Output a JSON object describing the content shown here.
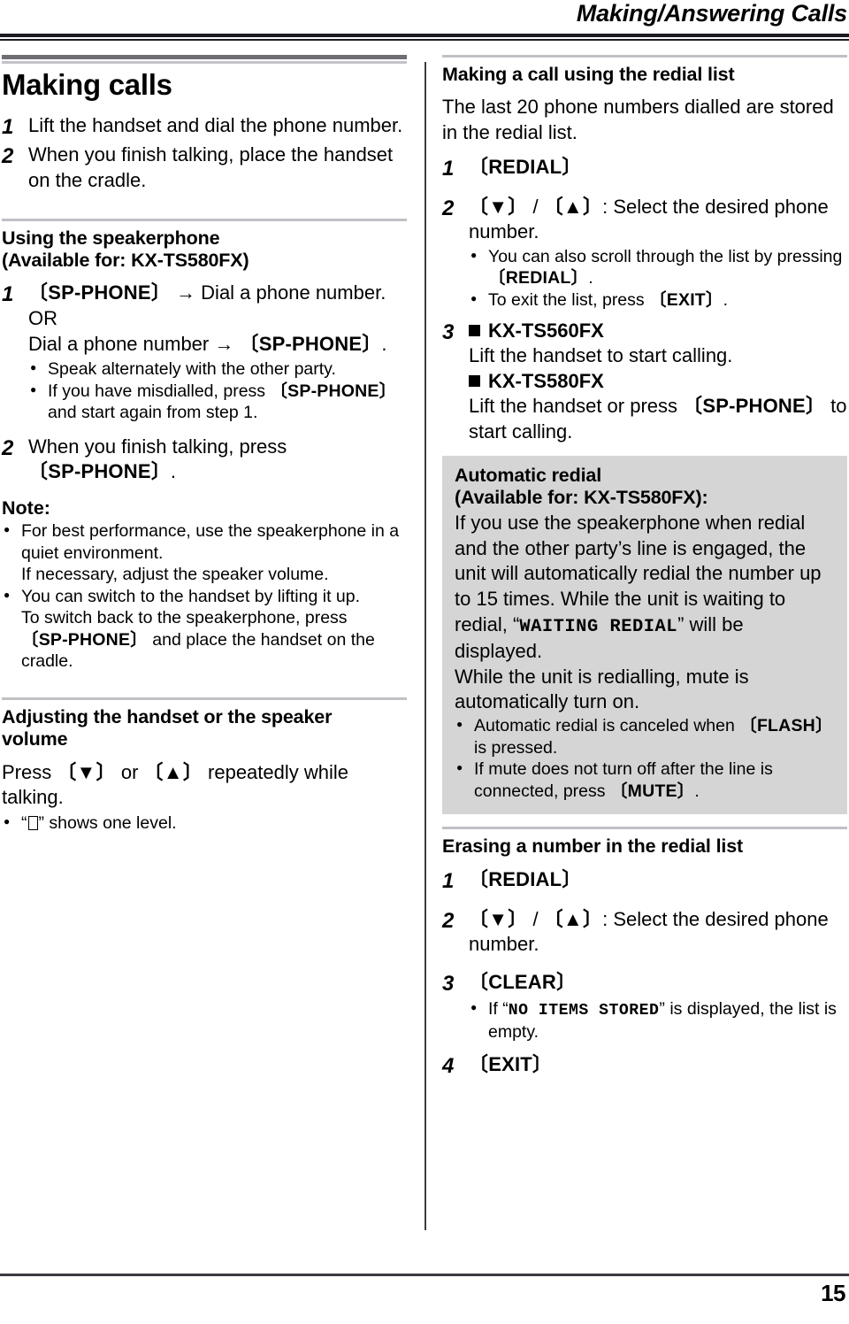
{
  "header": {
    "title": "Making/Answering Calls"
  },
  "footer": {
    "page_number": "15"
  },
  "left_column": {
    "main_title": "Making calls",
    "steps_basic": [
      {
        "num": "1",
        "text": "Lift the handset and dial the phone number."
      },
      {
        "num": "2",
        "text": "When you finish talking, place the handset on the cradle."
      }
    ],
    "speakerphone": {
      "heading_line1": "Using the speakerphone",
      "heading_line2": "(Available for: KX-TS580FX)",
      "step1_num": "1",
      "step1_key": "〔SP-PHONE〕",
      "step1_arrow": "→",
      "step1_rest": "Dial a phone number.",
      "step1_or": "OR",
      "step1_alt_pre": "Dial a phone number",
      "step1_alt_arrow": "→",
      "step1_alt_key": "〔SP-PHONE〕",
      "step1_alt_post": ".",
      "bullets": [
        {
          "text": "Speak alternately with the other party."
        },
        {
          "pre": "If you have misdialled, press ",
          "key": "〔SP-PHONE〕",
          "post": " and start again from step 1."
        }
      ],
      "step2_num": "2",
      "step2_pre": "When you finish talking, press",
      "step2_key": "〔SP-PHONE〕",
      "step2_post": "."
    },
    "note": {
      "heading": "Note:",
      "bullet1_line1": "For best performance, use the speakerphone in a quiet environment.",
      "bullet1_line2": "If necessary, adjust the speaker volume.",
      "bullet2_line1": "You can switch to the handset by lifting it up.",
      "bullet2_pre": "To switch back to the speakerphone, press ",
      "bullet2_key": "〔SP-PHONE〕",
      "bullet2_post": " and place the handset on the cradle."
    },
    "volume": {
      "heading_line1": "Adjusting the handset or the speaker",
      "heading_line2": "volume",
      "press_pre": "Press ",
      "key_down": "〔▼〕",
      "press_mid": " or ",
      "key_up": "〔▲〕",
      "press_post": " repeatedly while talking.",
      "bullet_pre": "“",
      "bullet_post": "” shows one level."
    }
  },
  "right_column": {
    "redial_call": {
      "heading": "Making a call using the redial list",
      "intro": "The last 20 phone numbers dialled are stored in the redial list.",
      "step1_num": "1",
      "step1_key": "〔REDIAL〕",
      "step2_num": "2",
      "step2_key_down": "〔▼〕",
      "step2_slash": " / ",
      "step2_key_up": "〔▲〕",
      "step2_rest": ": Select the desired phone number.",
      "step2_bullets": [
        {
          "pre": "You can also scroll through the list by pressing ",
          "key": "〔REDIAL〕",
          "post": "."
        },
        {
          "pre": "To exit the list, press ",
          "key": "〔EXIT〕",
          "post": "."
        }
      ],
      "step3_num": "3",
      "step3_model1": "KX-TS560FX",
      "step3_model1_text": "Lift the handset to start calling.",
      "step3_model2": "KX-TS580FX",
      "step3_model2_pre": "Lift the handset or press ",
      "step3_model2_key": "〔SP-PHONE〕",
      "step3_model2_post": " to start calling."
    },
    "auto_redial": {
      "heading_line1": "Automatic redial",
      "heading_line2": "(Available for: KX-TS580FX):",
      "body_pre": "If you use the speakerphone when redial and the other party’s line is engaged, the unit will automatically redial the number up to 15 times. While the unit is waiting to redial, “",
      "lcd_text": "WAITING REDIAL",
      "body_post": "” will be displayed.",
      "body_line2": "While the unit is redialling, mute is automatically turn on.",
      "bullets": [
        {
          "pre": "Automatic redial is canceled when ",
          "key": "〔FLASH〕",
          "post": " is pressed."
        },
        {
          "pre": "If mute does not turn off after the line is connected, press ",
          "key": "〔MUTE〕",
          "post": "."
        }
      ]
    },
    "erase_redial": {
      "heading": "Erasing a number in the redial list",
      "step1_num": "1",
      "step1_key": "〔REDIAL〕",
      "step2_num": "2",
      "step2_key_down": "〔▼〕",
      "step2_slash": " / ",
      "step2_key_up": "〔▲〕",
      "step2_rest": ": Select the desired phone number.",
      "step3_num": "3",
      "step3_key": "〔CLEAR〕",
      "step3_bullet_pre": "If “",
      "step3_bullet_lcd": "NO ITEMS STORED",
      "step3_bullet_post": "” is displayed, the list is empty.",
      "step4_num": "4",
      "step4_key": "〔EXIT〕"
    }
  },
  "colors": {
    "rule_dark": "#3b3b44",
    "rule_mid": "#6e6e74",
    "rule_light": "#c3c3c8",
    "callout_bg": "#d5d5d5"
  }
}
